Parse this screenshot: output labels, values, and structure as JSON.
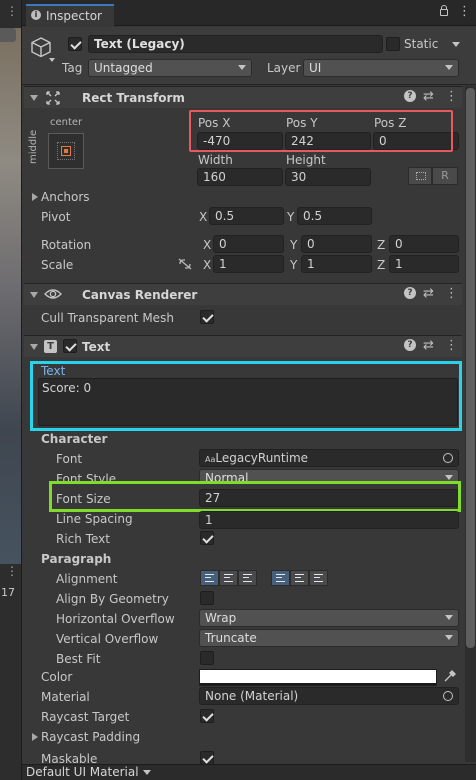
{
  "tab": {
    "title": "Inspector"
  },
  "object": {
    "name": "Text (Legacy)",
    "static_label": "Static",
    "tag_label": "Tag",
    "tag_value": "Untagged",
    "layer_label": "Layer",
    "layer_value": "UI"
  },
  "rect_transform": {
    "title": "Rect Transform",
    "anchor_h": "center",
    "anchor_v": "middle",
    "pos_x_label": "Pos X",
    "pos_y_label": "Pos Y",
    "pos_z_label": "Pos Z",
    "pos_x": "-470",
    "pos_y": "242",
    "pos_z": "0",
    "width_label": "Width",
    "height_label": "Height",
    "width": "160",
    "height": "30",
    "r_button": "R",
    "anchors_label": "Anchors",
    "pivot_label": "Pivot",
    "pivot_x": "0.5",
    "pivot_y": "0.5",
    "rotation_label": "Rotation",
    "rot_x": "0",
    "rot_y": "0",
    "rot_z": "0",
    "scale_label": "Scale",
    "scale_x": "1",
    "scale_y": "1",
    "scale_z": "1",
    "x": "X",
    "y": "Y",
    "z": "Z"
  },
  "canvas_renderer": {
    "title": "Canvas Renderer",
    "cull_label": "Cull Transparent Mesh"
  },
  "text_component": {
    "title": "Text",
    "text_label": "Text",
    "text_value": "Score: 0",
    "character_label": "Character",
    "font_label": "Font",
    "font_value": "LegacyRuntime",
    "font_prefix": "Aa",
    "font_style_label": "Font Style",
    "font_style_value": "Normal",
    "font_size_label": "Font Size",
    "font_size_value": "27",
    "line_spacing_label": "Line Spacing",
    "line_spacing_value": "1",
    "rich_text_label": "Rich Text",
    "paragraph_label": "Paragraph",
    "alignment_label": "Alignment",
    "align_by_geometry_label": "Align By Geometry",
    "h_overflow_label": "Horizontal Overflow",
    "h_overflow_value": "Wrap",
    "v_overflow_label": "Vertical Overflow",
    "v_overflow_value": "Truncate",
    "best_fit_label": "Best Fit",
    "color_label": "Color",
    "material_label": "Material",
    "material_value": "None (Material)",
    "raycast_target_label": "Raycast Target",
    "raycast_padding_label": "Raycast Padding",
    "maskable_label": "Maskable"
  },
  "footer": {
    "material_dropdown": "Default UI Material"
  },
  "left_panel": {
    "number": "17"
  },
  "highlight_colors": {
    "position": "#e8585f",
    "text": "#29d3ec",
    "font_size": "#7fdc2a"
  }
}
